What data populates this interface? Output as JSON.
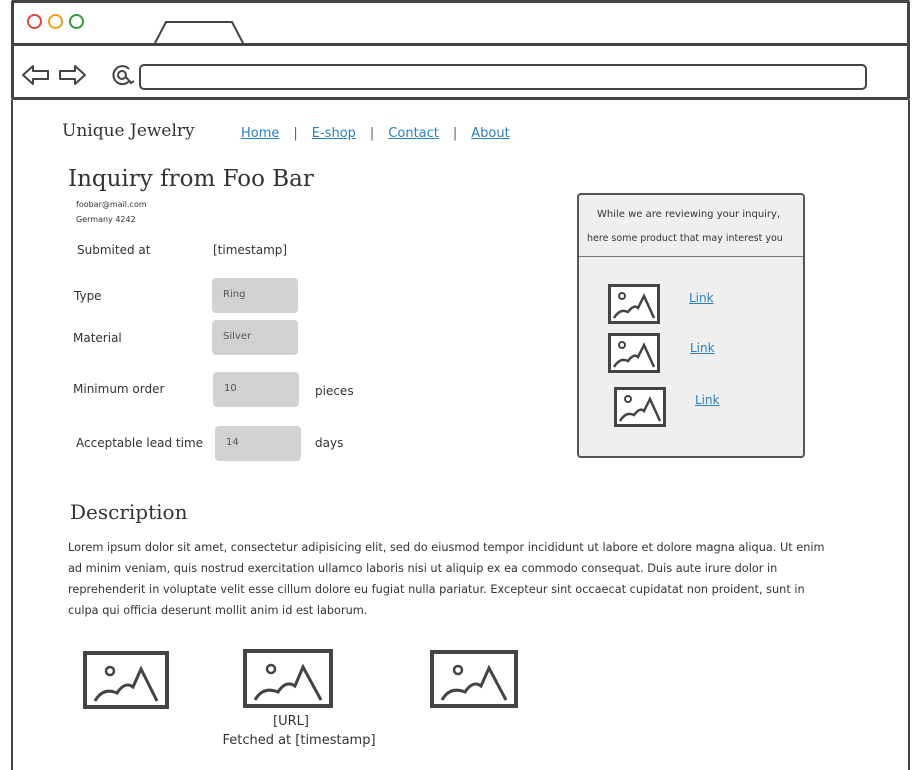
{
  "browser": {
    "tab_icon": "browser-tab",
    "back_icon": "arrow-left-icon",
    "forward_icon": "arrow-right-icon",
    "reload_icon": "reload-icon",
    "address": ""
  },
  "header": {
    "brand": "Unique Jewelry",
    "nav": [
      "Home",
      "E-shop",
      "Contact",
      "About"
    ]
  },
  "inquiry": {
    "title": "Inquiry from Foo Bar",
    "email": "foobar@mail.com",
    "country": "Germany 4242",
    "submitted_label": "Submited at",
    "submitted_value": "[timestamp]",
    "type_label": "Type",
    "type_value": "Ring",
    "material_label": "Material",
    "material_value": "Silver",
    "min_order_label": "Minimum order",
    "min_order_value": "10",
    "min_order_unit": "pieces",
    "lead_time_label": "Acceptable lead time",
    "lead_time_value": "14",
    "lead_time_unit": "days"
  },
  "panel": {
    "line1": "While we are reviewing your inquiry,",
    "line2": "here some product that may interest you",
    "links": [
      "Link",
      "Link",
      "Link"
    ]
  },
  "description": {
    "title": "Description",
    "text": "Lorem ipsum dolor sit amet, consectetur adipisicing elit, sed do eiusmod tempor incididunt ut labore et dolore magna aliqua. Ut enim ad minim veniam, quis nostrud exercitation ullamco laboris nisi ut aliquip ex ea commodo consequat. Duis aute irure dolor in reprehenderit in voluptate velit esse cillum dolore eu fugiat nulla pariatur. Excepteur sint occaecat cupidatat non proident, sunt in culpa qui officia deserunt mollit anim id est laborum."
  },
  "attachments": {
    "url": "[URL]",
    "fetched": "Fetched at [timestamp]"
  }
}
